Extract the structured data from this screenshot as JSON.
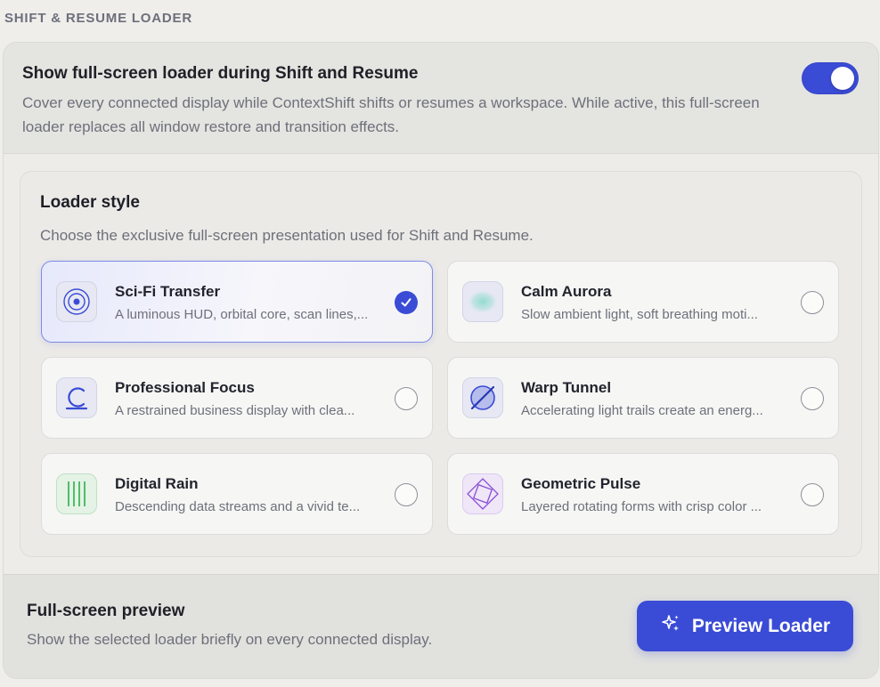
{
  "section": {
    "title": "SHIFT & RESUME LOADER"
  },
  "master": {
    "title": "Show full-screen loader during Shift and Resume",
    "description": "Cover every connected display while ContextShift shifts or resumes a workspace. While active, this full-screen loader replaces all window restore and transition effects.",
    "enabled": true
  },
  "loader_style": {
    "title": "Loader style",
    "description": "Choose the exclusive full-screen presentation used for Shift and Resume.",
    "options": [
      {
        "name": "Sci-Fi Transfer",
        "description": "A luminous HUD, orbital core, scan lines,...",
        "icon": "orbital-core-icon",
        "selected": true
      },
      {
        "name": "Calm Aurora",
        "description": "Slow ambient light, soft breathing moti...",
        "icon": "aurora-glow-icon",
        "selected": false
      },
      {
        "name": "Professional Focus",
        "description": "A restrained business display with clea...",
        "icon": "focus-arc-icon",
        "selected": false
      },
      {
        "name": "Warp Tunnel",
        "description": "Accelerating light trails create an energ...",
        "icon": "warp-tunnel-icon",
        "selected": false
      },
      {
        "name": "Digital Rain",
        "description": "Descending data streams and a vivid te...",
        "icon": "digital-rain-icon",
        "selected": false
      },
      {
        "name": "Geometric Pulse",
        "description": "Layered rotating forms with crisp color ...",
        "icon": "geometric-pulse-icon",
        "selected": false
      }
    ]
  },
  "preview": {
    "title": "Full-screen preview",
    "description": "Show the selected loader briefly on every connected display.",
    "button_label": "Preview Loader",
    "button_icon": "sparkles-icon"
  },
  "colors": {
    "accent": "#3a4cd6",
    "rain": "#2fae4a",
    "pulse": "#8a4fd6",
    "aurora": "#8fd9cf"
  }
}
